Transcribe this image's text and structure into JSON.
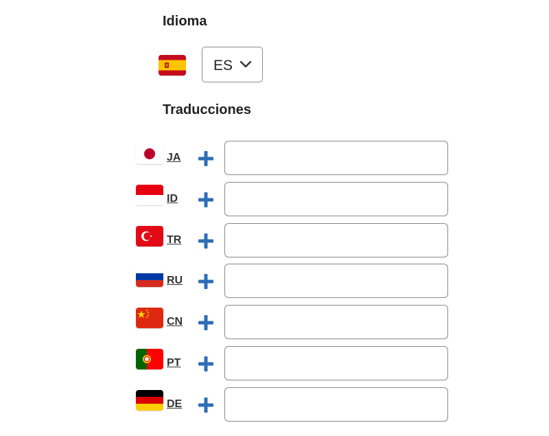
{
  "language_section": {
    "title": "Idioma",
    "flag_icon": "spain-flag-icon",
    "selected": "ES"
  },
  "translations_section": {
    "title": "Traducciones",
    "plus_color": "#2f6db5",
    "rows": [
      {
        "code": "JA",
        "flag_icon": "japan-flag-icon",
        "value": "",
        "placeholder": ""
      },
      {
        "code": "ID",
        "flag_icon": "indonesia-flag-icon",
        "value": "",
        "placeholder": ""
      },
      {
        "code": "TR",
        "flag_icon": "turkey-flag-icon",
        "value": "",
        "placeholder": ""
      },
      {
        "code": "RU",
        "flag_icon": "russia-flag-icon",
        "value": "",
        "placeholder": ""
      },
      {
        "code": "CN",
        "flag_icon": "china-flag-icon",
        "value": "",
        "placeholder": ""
      },
      {
        "code": "PT",
        "flag_icon": "portugal-flag-icon",
        "value": "",
        "placeholder": ""
      },
      {
        "code": "DE",
        "flag_icon": "germany-flag-icon",
        "value": "",
        "placeholder": ""
      }
    ]
  }
}
